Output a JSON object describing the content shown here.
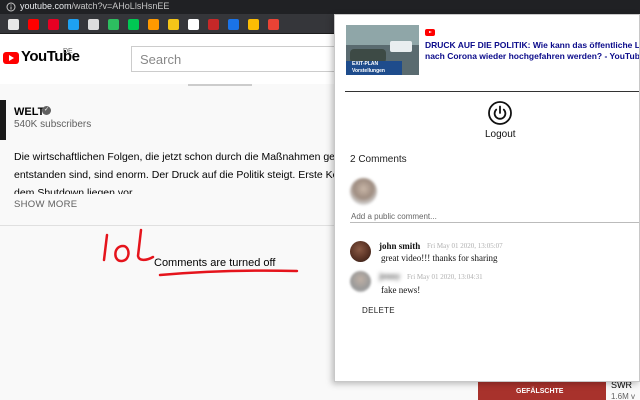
{
  "browser": {
    "url_host": "youtube.com",
    "url_path": "/watch?v=AHoLlsHsnEE",
    "bookmark_icons": [
      {
        "name": "chrome-icon",
        "color": "#e8e8e8"
      },
      {
        "name": "youtube-icon",
        "color": "#ff0000"
      },
      {
        "name": "pinterest-icon",
        "color": "#e60023"
      },
      {
        "name": "twitter-icon",
        "color": "#1da1f2"
      },
      {
        "name": "m-icon",
        "color": "#dddddd"
      },
      {
        "name": "evernote-icon",
        "color": "#2dbe60"
      },
      {
        "name": "extension-icon",
        "color": "#00c853"
      },
      {
        "name": "amazon-icon",
        "color": "#ff9900"
      },
      {
        "name": "notes-icon",
        "color": "#f5c518"
      },
      {
        "name": "bookmark-icon",
        "color": "#ffffff"
      },
      {
        "name": "shop-icon",
        "color": "#c62828"
      },
      {
        "name": "calendar-icon",
        "color": "#1a73e8"
      },
      {
        "name": "drive-icon",
        "color": "#fbbc04"
      },
      {
        "name": "gmail-icon",
        "color": "#ea4335"
      }
    ]
  },
  "youtube": {
    "logo_text": "YouTube",
    "logo_region": "DE",
    "search_placeholder": "Search",
    "channel": {
      "name": "WELT",
      "verified_icon": "checkmark-circle-icon",
      "subscribers": "540K subscribers"
    },
    "description_lines": [
      "Die wirtschaftlichen Folgen, die jetzt schon durch die Maßnahmen ge",
      "entstanden sind, sind enorm. Der Druck auf die Politik steigt. Erste Ko",
      "dem Shutdown liegen vor."
    ],
    "show_more": "SHOW MORE",
    "comments_off": "Comments are turned off",
    "scribble_text": "lol",
    "bottom_thumb_text": "GEFÄLSCHTE",
    "bottom_channel": "SWR",
    "bottom_views": "1.6M v"
  },
  "popup": {
    "thumb_banner_line1": "EXIT-PLAN",
    "thumb_banner_line2": "Vorstellungen",
    "video_title_line1": "DRUCK AUF DIE POLITIK: Wie kann das öffentliche L",
    "video_title_line2": "nach Corona wieder hochgefahren werden? - YouTub",
    "logout_label": "Logout",
    "comments_count": "2 Comments",
    "add_comment_placeholder": "Add a public comment...",
    "comments": [
      {
        "author": "john smith",
        "date": "Fri May 01 2020, 13:05:07",
        "text": "great video!!! thanks for sharing"
      },
      {
        "author": "jenny",
        "date": "Fri May 01 2020, 13:04:31",
        "text": "fake news!"
      }
    ],
    "delete_label": "DELETE"
  },
  "colors": {
    "youtube_red": "#ff0000",
    "title_link": "#0a0a8a",
    "scribble": "#e5141c"
  }
}
